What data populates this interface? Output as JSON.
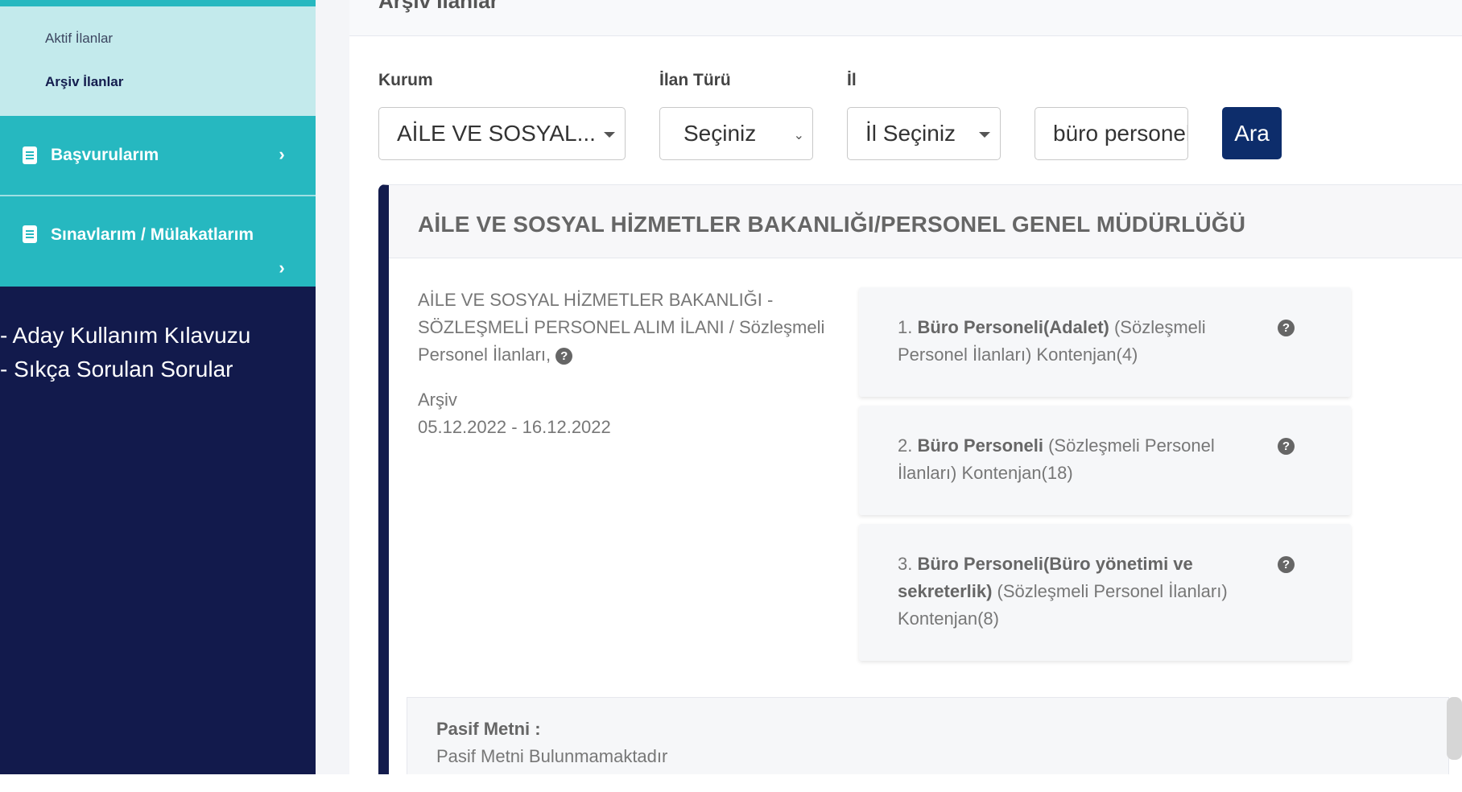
{
  "sidebar": {
    "sub_items": [
      "Aktif İlanlar",
      "Arşiv İlanlar"
    ],
    "menu": [
      {
        "label": "Başvurularım",
        "icon": "document-icon"
      },
      {
        "label": "Sınavlarım / Mülakatlarım",
        "icon": "document-icon"
      }
    ],
    "links": [
      "- Aday Kullanım Kılavuzu",
      "- Sıkça Sorulan Sorular"
    ]
  },
  "header": {
    "title": "Arşiv İlanlar"
  },
  "filters": {
    "kurum": {
      "label": "Kurum",
      "value": "AİLE VE SOSYAL..."
    },
    "ilan_turu": {
      "label": "İlan Türü",
      "value": "Seçiniz"
    },
    "il": {
      "label": "İl",
      "value": "İl Seçiniz"
    },
    "search": {
      "value": "büro personeli"
    },
    "search_button": "Ara"
  },
  "listing": {
    "institution": "AİLE VE SOSYAL HİZMETLER BAKANLIĞI/PERSONEL GENEL MÜDÜRLÜĞÜ",
    "description": "AİLE VE SOSYAL HİZMETLER BAKANLIĞI - SÖZLEŞMELİ PERSONEL ALIM İLANI / Sözleşmeli Personel İlanları,",
    "status": "Arşiv",
    "dates": "05.12.2022 - 16.12.2022",
    "positions": [
      {
        "num": "1.",
        "title": "Büro Personeli(Adalet)",
        "detail": "(Sözleşmeli Personel İlanları) Kontenjan(4)"
      },
      {
        "num": "2.",
        "title": "Büro Personeli",
        "detail": "(Sözleşmeli Personel İlanları) Kontenjan(18)"
      },
      {
        "num": "3.",
        "title": "Büro Personeli(Büro yönetimi ve sekreterlik)",
        "detail": "(Sözleşmeli Personel İlanları) Kontenjan(8)"
      }
    ],
    "pasif_label": "Pasif Metni :",
    "pasif_text": "Pasif Metni Bulunmamaktadır"
  },
  "colors": {
    "sidebar_bg": "#121a4c",
    "teal": "#26b8c0",
    "teal_light": "#c3eaec",
    "button": "#0d2d6b"
  }
}
